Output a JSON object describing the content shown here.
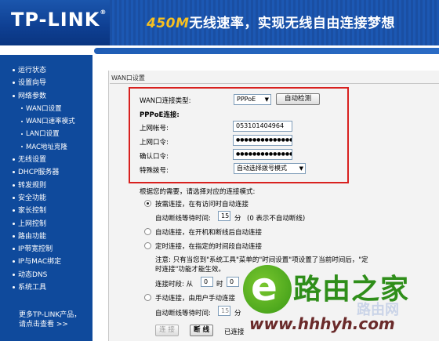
{
  "header": {
    "logo": "TP-LINK",
    "logo_reg": "®",
    "slogan_highlight": "450M",
    "slogan_rest": "无线速率，实现无线自由连接梦想"
  },
  "sidebar": {
    "items": [
      {
        "label": "运行状态",
        "sub": false
      },
      {
        "label": "设置向导",
        "sub": false
      },
      {
        "label": "网络参数",
        "sub": false
      },
      {
        "label": "WAN口设置",
        "sub": true
      },
      {
        "label": "WAN口速率模式",
        "sub": true
      },
      {
        "label": "LAN口设置",
        "sub": true
      },
      {
        "label": "MAC地址克隆",
        "sub": true
      },
      {
        "label": "无线设置",
        "sub": false
      },
      {
        "label": "DHCP服务器",
        "sub": false
      },
      {
        "label": "转发规则",
        "sub": false
      },
      {
        "label": "安全功能",
        "sub": false
      },
      {
        "label": "家长控制",
        "sub": false
      },
      {
        "label": "上网控制",
        "sub": false
      },
      {
        "label": "路由功能",
        "sub": false
      },
      {
        "label": "IP带宽控制",
        "sub": false
      },
      {
        "label": "IP与MAC绑定",
        "sub": false
      },
      {
        "label": "动态DNS",
        "sub": false
      },
      {
        "label": "系统工具",
        "sub": false
      }
    ],
    "more_line1": "更多TP-LINK产品，",
    "more_line2": "请点击查看 >>"
  },
  "panel": {
    "title": "WAN口设置",
    "conn_type_label": "WAN口连接类型:",
    "conn_type_value": "PPPoE",
    "autodetect_btn": "自动检测",
    "pppoe_heading": "PPPoE连接:",
    "account_label": "上网帐号:",
    "account_value": "053101404964",
    "password_label": "上网口令:",
    "password_value": "●●●●●●●●●●●●●●●●",
    "confirm_label": "确认口令:",
    "confirm_value": "●●●●●●●●●●●●●●●●",
    "dial_label": "特殊拨号:",
    "dial_value": "自动选择拨号模式",
    "mode_intro": "根据您的需要，请选择对应的连接模式:",
    "opt1": "按需连接，在有访问时自动连接",
    "idle_label": "自动断线等待时间:",
    "idle_value": "15",
    "idle_unit": "分",
    "idle_hint": "(0 表示不自动断线)",
    "opt2": "自动连接，在开机和断线后自动连接",
    "opt3": "定时连接，在指定的时间段自动连接",
    "note_line1": "注意: 只有当您到\"系统工具\"菜单的\"时间设置\"项设置了当前时间后，\"定",
    "note_line2": "时连接\"功能才能生效。",
    "period_label": "连接时段: 从",
    "period_from": "0",
    "period_mid": "时",
    "period_to": "0",
    "opt4": "手动连接，由用户手动连接",
    "idle2_label": "自动断线等待时间:",
    "idle2_value": "15",
    "idle2_unit": "分",
    "connect_btn": "连 接",
    "disconnect_btn": "断 线",
    "status_text": "已连接"
  },
  "watermark": {
    "logo_char": "e",
    "brand": "路由之家",
    "url": "www.hhhyh.com",
    "faint": "路由网"
  },
  "colors": {
    "header_blue": "#0e3f92",
    "sidebar_blue": "#0f4a9c",
    "highlight_red": "#d8211f",
    "slogan_yellow": "#f7c020",
    "watermark_green": "#2f8e1a"
  }
}
